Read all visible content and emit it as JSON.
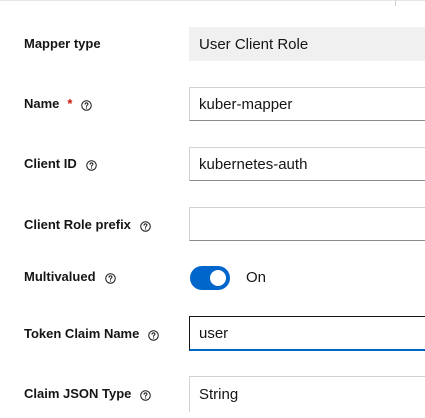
{
  "form": {
    "mapper_type": {
      "label": "Mapper type",
      "value": "User Client Role"
    },
    "name": {
      "label": "Name",
      "required_mark": "*",
      "value": "kuber-mapper"
    },
    "client_id": {
      "label": "Client ID",
      "value": "kubernetes-auth"
    },
    "client_role_prefix": {
      "label": "Client Role prefix",
      "value": ""
    },
    "multivalued": {
      "label": "Multivalued",
      "state_label": "On",
      "enabled": true
    },
    "token_claim_name": {
      "label": "Token Claim Name",
      "value": "user"
    },
    "claim_json_type": {
      "label": "Claim JSON Type",
      "value": "String"
    }
  },
  "colors": {
    "accent": "#0066cc",
    "required": "#c9190b",
    "readonly_bg": "#f0f0f0"
  },
  "icons": {
    "help": "help-circle-icon"
  }
}
